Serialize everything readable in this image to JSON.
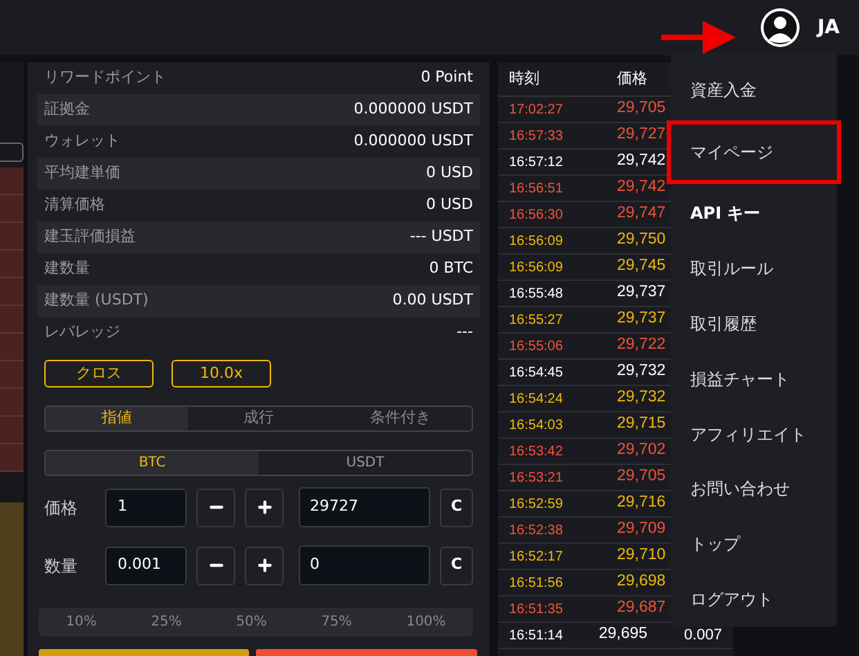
{
  "header": {
    "language": "JA"
  },
  "account": [
    {
      "label": "リワードポイント",
      "value": "0 Point"
    },
    {
      "label": "証拠金",
      "value": "0.000000 USDT"
    },
    {
      "label": "ウォレット",
      "value": "0.000000 USDT"
    },
    {
      "label": "平均建単価",
      "value": "0 USD"
    },
    {
      "label": "清算価格",
      "value": "0 USD"
    },
    {
      "label": "建玉評価損益",
      "value": "--- USDT"
    },
    {
      "label": "建数量",
      "value": "0 BTC"
    },
    {
      "label": "建数量 (USDT)",
      "value": "0.00 USDT"
    },
    {
      "label": "レバレッジ",
      "value": "---"
    }
  ],
  "margin_mode": "クロス",
  "leverage": "10.0x",
  "order_types": [
    {
      "label": "指値",
      "selected": true
    },
    {
      "label": "成行",
      "selected": false
    },
    {
      "label": "条件付き",
      "selected": false
    }
  ],
  "units": [
    {
      "label": "BTC",
      "selected": true
    },
    {
      "label": "USDT",
      "selected": false
    }
  ],
  "inputs": [
    {
      "label": "価格",
      "step": "1",
      "value": "29727",
      "clear": "C"
    },
    {
      "label": "数量",
      "step": "0.001",
      "value": "0",
      "clear": "C"
    }
  ],
  "percents": [
    "10%",
    "25%",
    "50%",
    "75%",
    "100%"
  ],
  "trades": {
    "columns": [
      "時刻",
      "価格"
    ],
    "rows": [
      {
        "time": "17:02:27",
        "price": "29,705",
        "color": "#f0533a"
      },
      {
        "time": "16:57:33",
        "price": "29,727",
        "color": "#f0533a"
      },
      {
        "time": "16:57:12",
        "price": "29,742",
        "color": "#ffffff"
      },
      {
        "time": "16:56:51",
        "price": "29,742",
        "color": "#f0533a"
      },
      {
        "time": "16:56:30",
        "price": "29,747",
        "color": "#f0533a"
      },
      {
        "time": "16:56:09",
        "price": "29,750",
        "color": "#f0b90b"
      },
      {
        "time": "16:56:09",
        "price": "29,745",
        "color": "#f0b90b"
      },
      {
        "time": "16:55:48",
        "price": "29,737",
        "color": "#ffffff"
      },
      {
        "time": "16:55:27",
        "price": "29,737",
        "color": "#f0b90b"
      },
      {
        "time": "16:55:06",
        "price": "29,722",
        "color": "#f0533a"
      },
      {
        "time": "16:54:45",
        "price": "29,732",
        "color": "#ffffff"
      },
      {
        "time": "16:54:24",
        "price": "29,732",
        "color": "#f0b90b"
      },
      {
        "time": "16:54:03",
        "price": "29,715",
        "color": "#f0b90b"
      },
      {
        "time": "16:53:42",
        "price": "29,702",
        "color": "#f0533a"
      },
      {
        "time": "16:53:21",
        "price": "29,705",
        "color": "#f0533a"
      },
      {
        "time": "16:52:59",
        "price": "29,716",
        "color": "#f0b90b"
      },
      {
        "time": "16:52:38",
        "price": "29,709",
        "color": "#f0533a"
      },
      {
        "time": "16:52:17",
        "price": "29,710",
        "color": "#f0b90b"
      },
      {
        "time": "16:51:56",
        "price": "29,698",
        "color": "#f0b90b"
      },
      {
        "time": "16:51:35",
        "price": "29,687",
        "color": "#f0533a"
      },
      {
        "time": "16:51:14",
        "price": "29,695",
        "column_3": "0.007",
        "color": "#ffffff"
      }
    ]
  },
  "menu": [
    {
      "label": "資産入金",
      "highlighted": false
    },
    {
      "label": "マイページ",
      "highlighted": true
    },
    {
      "label": "API キー",
      "highlighted": false,
      "bold": true
    },
    {
      "label": "取引ルール",
      "highlighted": false
    },
    {
      "label": "取引履歴",
      "highlighted": false
    },
    {
      "label": "損益チャート",
      "highlighted": false
    },
    {
      "label": "アフィリエイト",
      "highlighted": false
    },
    {
      "label": "お問い合わせ",
      "highlighted": false
    },
    {
      "label": "トップ",
      "highlighted": false
    },
    {
      "label": "ログアウト",
      "highlighted": false
    }
  ]
}
